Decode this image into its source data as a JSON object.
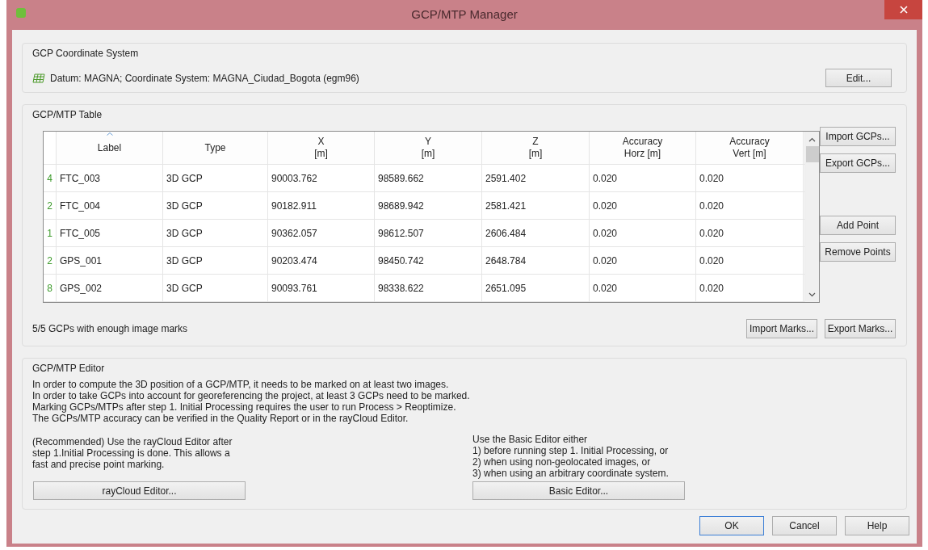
{
  "window": {
    "title": "GCP/MTP Manager"
  },
  "coordinate_system": {
    "title": "GCP Coordinate System",
    "text": "Datum: MAGNA; Coordinate System: MAGNA_Ciudad_Bogota (egm96)",
    "button": "Edit..."
  },
  "table_group": {
    "title": "GCP/MTP Table",
    "columns": [
      {
        "label": "Label",
        "sorted": true
      },
      {
        "label": "Type",
        "sorted": false
      },
      {
        "label": "X\n[m]",
        "sorted": false
      },
      {
        "label": "Y\n[m]",
        "sorted": false
      },
      {
        "label": "Z\n[m]",
        "sorted": false
      },
      {
        "label": "Accuracy\nHorz [m]",
        "sorted": false
      },
      {
        "label": "Accuracy\nVert [m]",
        "sorted": false
      }
    ],
    "rows": [
      {
        "marks": "4",
        "cells": [
          "FTC_003",
          "3D GCP",
          "90003.762",
          "98589.662",
          "2591.402",
          "0.020",
          "0.020"
        ]
      },
      {
        "marks": "2",
        "cells": [
          "FTC_004",
          "3D GCP",
          "90182.911",
          "98689.942",
          "2581.421",
          "0.020",
          "0.020"
        ]
      },
      {
        "marks": "1",
        "cells": [
          "FTC_005",
          "3D GCP",
          "90362.057",
          "98612.507",
          "2606.484",
          "0.020",
          "0.020"
        ]
      },
      {
        "marks": "2",
        "cells": [
          "GPS_001",
          "3D GCP",
          "90203.474",
          "98450.742",
          "2648.784",
          "0.020",
          "0.020"
        ]
      },
      {
        "marks": "8",
        "cells": [
          "GPS_002",
          "3D GCP",
          "90093.761",
          "98338.622",
          "2651.095",
          "0.020",
          "0.020"
        ]
      }
    ],
    "side_buttons_top": [
      "Import GCPs...",
      "Export GCPs..."
    ],
    "side_buttons_bottom": [
      "Add Point",
      "Remove Points"
    ],
    "status": "5/5 GCPs with enough image marks",
    "marks_buttons": [
      "Import Marks...",
      "Export Marks..."
    ]
  },
  "editor": {
    "title": "GCP/MTP Editor",
    "intro": [
      "In order to compute the 3D position of a GCP/MTP, it needs to be marked on at least two images.",
      "In order to take GCPs into account for georeferencing the project, at least 3 GCPs need to be marked.",
      "Marking GCPs/MTPs after step 1. Initial Processing requires the user to run Process > Reoptimize.",
      "The GCPs/MTP accuracy can be verified in the Quality Report or in the rayCloud Editor."
    ],
    "left": {
      "lines": [
        "(Recommended) Use the rayCloud Editor after",
        "step 1.Initial Processing is done. This allows a",
        "fast and precise point marking."
      ],
      "button": "rayCloud Editor..."
    },
    "right": {
      "lines": [
        "Use the Basic Editor either",
        "1) before running step 1. Initial Processing, or",
        "2) when using non-geolocated images, or",
        "3) when using an arbitrary coordinate system."
      ],
      "button": "Basic Editor..."
    }
  },
  "buttons": [
    {
      "label": "OK",
      "default": true
    },
    {
      "label": "Cancel",
      "default": false
    },
    {
      "label": "Help",
      "default": false
    }
  ]
}
